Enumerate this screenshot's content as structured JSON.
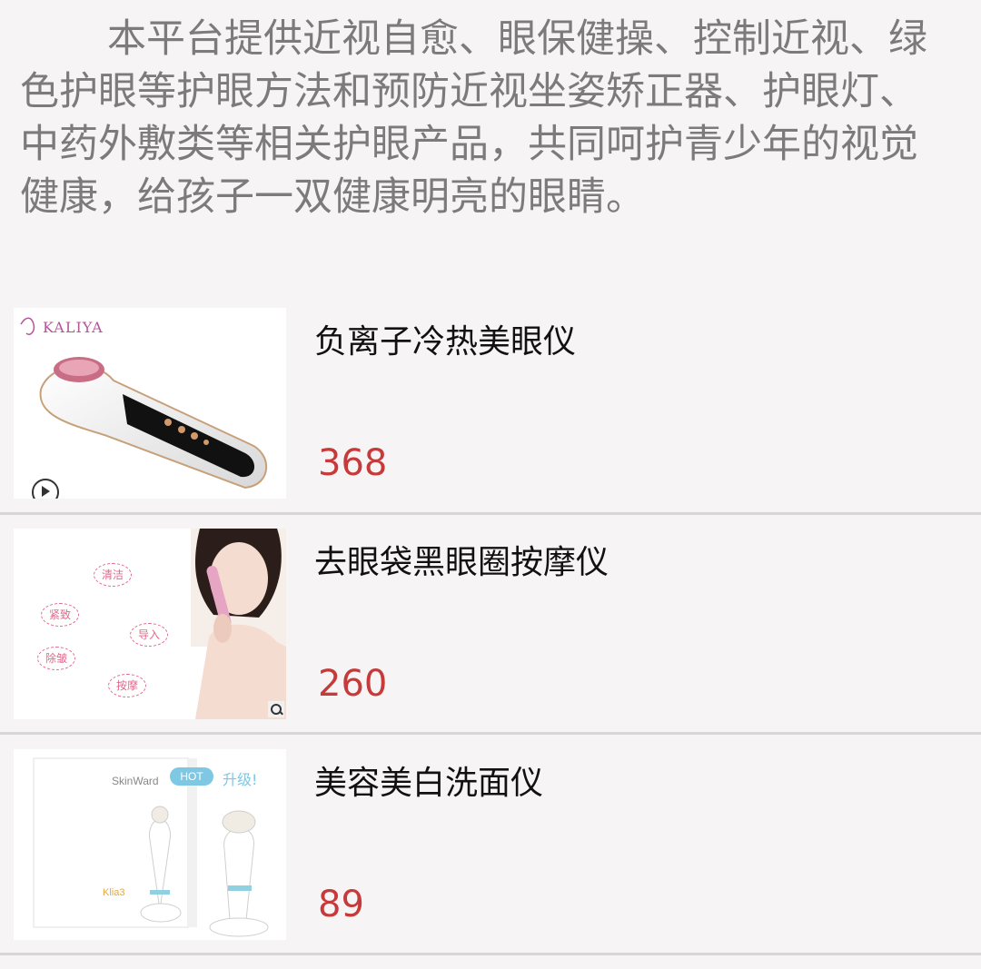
{
  "intro": {
    "text": "本平台提供近视自愈、眼保健操、控制近视、绿色护眼等护眼方法和预防近视坐姿矫正器、护眼灯、中药外敷类等相关护眼产品，共同呵护青少年的视觉健康，给孩子一双健康明亮的眼睛。"
  },
  "products": [
    {
      "title": "负离子冷热美眼仪",
      "price": "368",
      "image_brand": "KALIYA",
      "image_icon": "play-icon"
    },
    {
      "title": "去眼袋黑眼圈按摩仪",
      "price": "260",
      "image_labels": [
        "清洁",
        "紧致",
        "导入",
        "除皱",
        "按摩"
      ],
      "image_icon": "magnifier-icon"
    },
    {
      "title": "美容美白洗面仪",
      "price": "89",
      "image_brand": "SkinWard",
      "image_badge": "HOT",
      "image_tag": "升级!",
      "image_model": "Klia3"
    }
  ],
  "colors": {
    "price": "#c63a3a",
    "intro_text": "#7b7b7b",
    "background": "#f7f4f6",
    "divider": "#d9d6d8"
  }
}
